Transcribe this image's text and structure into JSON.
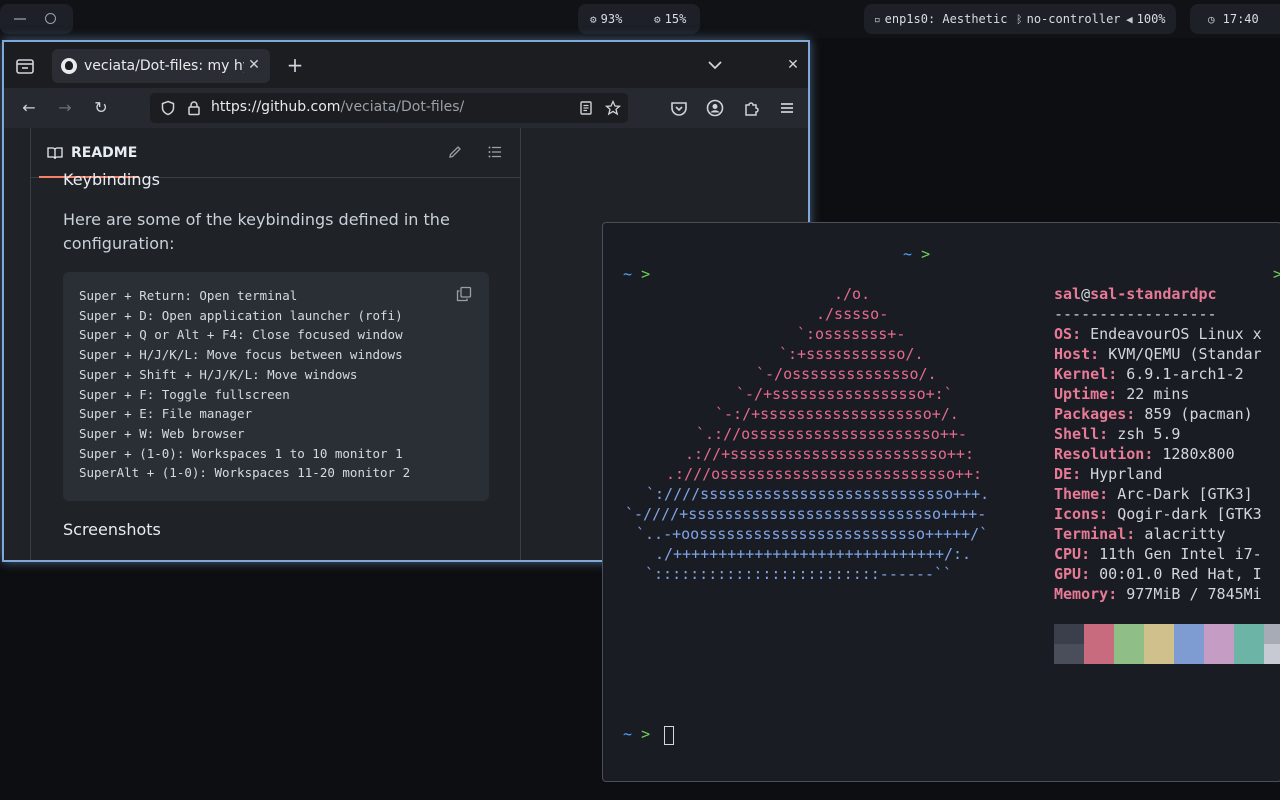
{
  "topbar": {
    "cpu": "93%",
    "mem": "15%",
    "network": "enp1s0: Aesthetic",
    "bluetooth": "no-controller",
    "volume": "100%",
    "clock": "17:40"
  },
  "browser": {
    "tab_title": "veciata/Dot-files: my hypr",
    "url_domain": "https://github.com",
    "url_path": "/veciata/Dot-files/",
    "readme_tab": "README",
    "section_keybindings": "Keybindings",
    "intro": "Here are some of the keybindings defined in the configuration:",
    "code_lines": [
      "Super + Return: Open terminal",
      "Super + D: Open application launcher (rofi)",
      "Super + Q or Alt + F4: Close focused window",
      "Super + H/J/K/L: Move focus between windows",
      "Super + Shift + H/J/K/L: Move windows",
      "Super + F: Toggle fullscreen",
      "Super + E: File manager",
      "Super + W: Web browser",
      "Super + (1-0): Workspaces 1 to 10 monitor 1",
      "SuperAlt + (1-0): Workspaces 11-20 monitor 2"
    ],
    "section_screenshots": "Screenshots"
  },
  "terminal": {
    "prompt_tilde": "~",
    "prompt_gt": ">",
    "ascii_art": [
      "./o.",
      "./sssso-",
      "`:osssssss+-",
      "`:+sssssssssso/.",
      "`-/ossssssssssssso/.",
      "`-/+sssssssssssssssso+:`",
      "`-:/+sssssssssssssssssso+/.",
      "`.://osssssssssssssssssssso++-",
      ".://+ssssssssssssssssssssssso++:",
      ".:///ossssssssssssssssssssssssso++:",
      "`:////ssssssssssssssssssssssssssso+++.",
      "`-////+ssssssssssssssssssssssssssso++++-",
      "`..-+oosssssssssssssssssssssssso+++++/`",
      "./++++++++++++++++++++++++++++++/:.",
      "`:::::::::::::::::::::::::------``"
    ],
    "user": "sal",
    "at": "@",
    "host": "sal-standardpc",
    "separator": "------------------",
    "info": [
      {
        "key": "OS",
        "value": "EndeavourOS Linux x"
      },
      {
        "key": "Host",
        "value": "KVM/QEMU (Standar"
      },
      {
        "key": "Kernel",
        "value": "6.9.1-arch1-2"
      },
      {
        "key": "Uptime",
        "value": "22 mins"
      },
      {
        "key": "Packages",
        "value": "859 (pacman)"
      },
      {
        "key": "Shell",
        "value": "zsh 5.9"
      },
      {
        "key": "Resolution",
        "value": "1280x800"
      },
      {
        "key": "DE",
        "value": "Hyprland"
      },
      {
        "key": "Theme",
        "value": "Arc-Dark [GTK3]"
      },
      {
        "key": "Icons",
        "value": "Qogir-dark [GTK3"
      },
      {
        "key": "Terminal",
        "value": "alacritty"
      },
      {
        "key": "CPU",
        "value": "11th Gen Intel i7-"
      },
      {
        "key": "GPU",
        "value": "00:01.0 Red Hat, I"
      },
      {
        "key": "Memory",
        "value": "977MiB / 7845Mi"
      }
    ],
    "palette_top": [
      "#3b3f4c",
      "#c96b7e",
      "#8fbf87",
      "#d0c08c",
      "#7e9bd2",
      "#c59cc4",
      "#6cb5a6",
      "#a7abb6"
    ],
    "palette_bottom": [
      "#4a4e5b",
      "#c96b7e",
      "#8fbf87",
      "#d0c08c",
      "#7e9bd2",
      "#c59cc4",
      "#6cb5a6",
      "#c7cad2"
    ]
  }
}
